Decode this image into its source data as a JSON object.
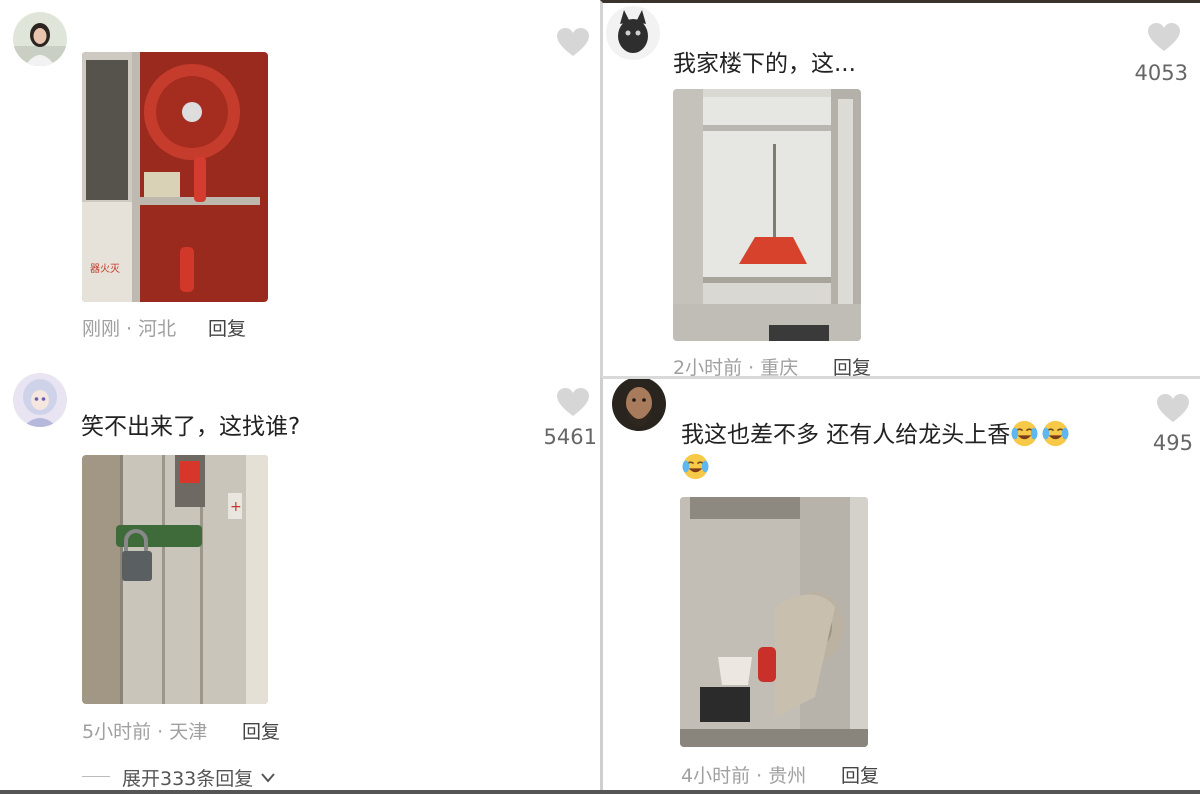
{
  "comments": [
    {
      "text": "",
      "time_location": "刚刚 · 河北",
      "reply_label": "回复",
      "likes": "",
      "icons": {
        "avatar": "avatar-girl-photo",
        "like": "heart-icon",
        "photo": "fire-hydrant-cabinet-photo"
      }
    },
    {
      "text": "笑不出来了，这找谁?",
      "time_location": "5小时前 · 天津",
      "reply_label": "回复",
      "likes": "5461",
      "icons": {
        "avatar": "avatar-anime-girl",
        "like": "heart-icon",
        "photo": "locked-cabinet-photo"
      },
      "expand_label": "展开333条回复"
    },
    {
      "text": "我家楼下的，这...",
      "time_location": "2小时前 · 重庆",
      "reply_label": "回复",
      "likes": "4053",
      "icons": {
        "avatar": "avatar-animal",
        "like": "heart-icon",
        "photo": "cabinet-with-broom-photo"
      }
    },
    {
      "text": "我这也差不多 还有人给龙头上香",
      "time_location": "4小时前 · 贵州",
      "reply_label": "回复",
      "likes": "495",
      "icons": {
        "avatar": "avatar-bearded-man",
        "like": "heart-icon",
        "photo": "dusty-hose-cabinet-photo",
        "emoji": "crying-laughing-emoji"
      }
    }
  ],
  "colors": {
    "text": "#222222",
    "meta": "#a0a0a0",
    "heart": "#d6d6d6",
    "likes": "#666666"
  }
}
